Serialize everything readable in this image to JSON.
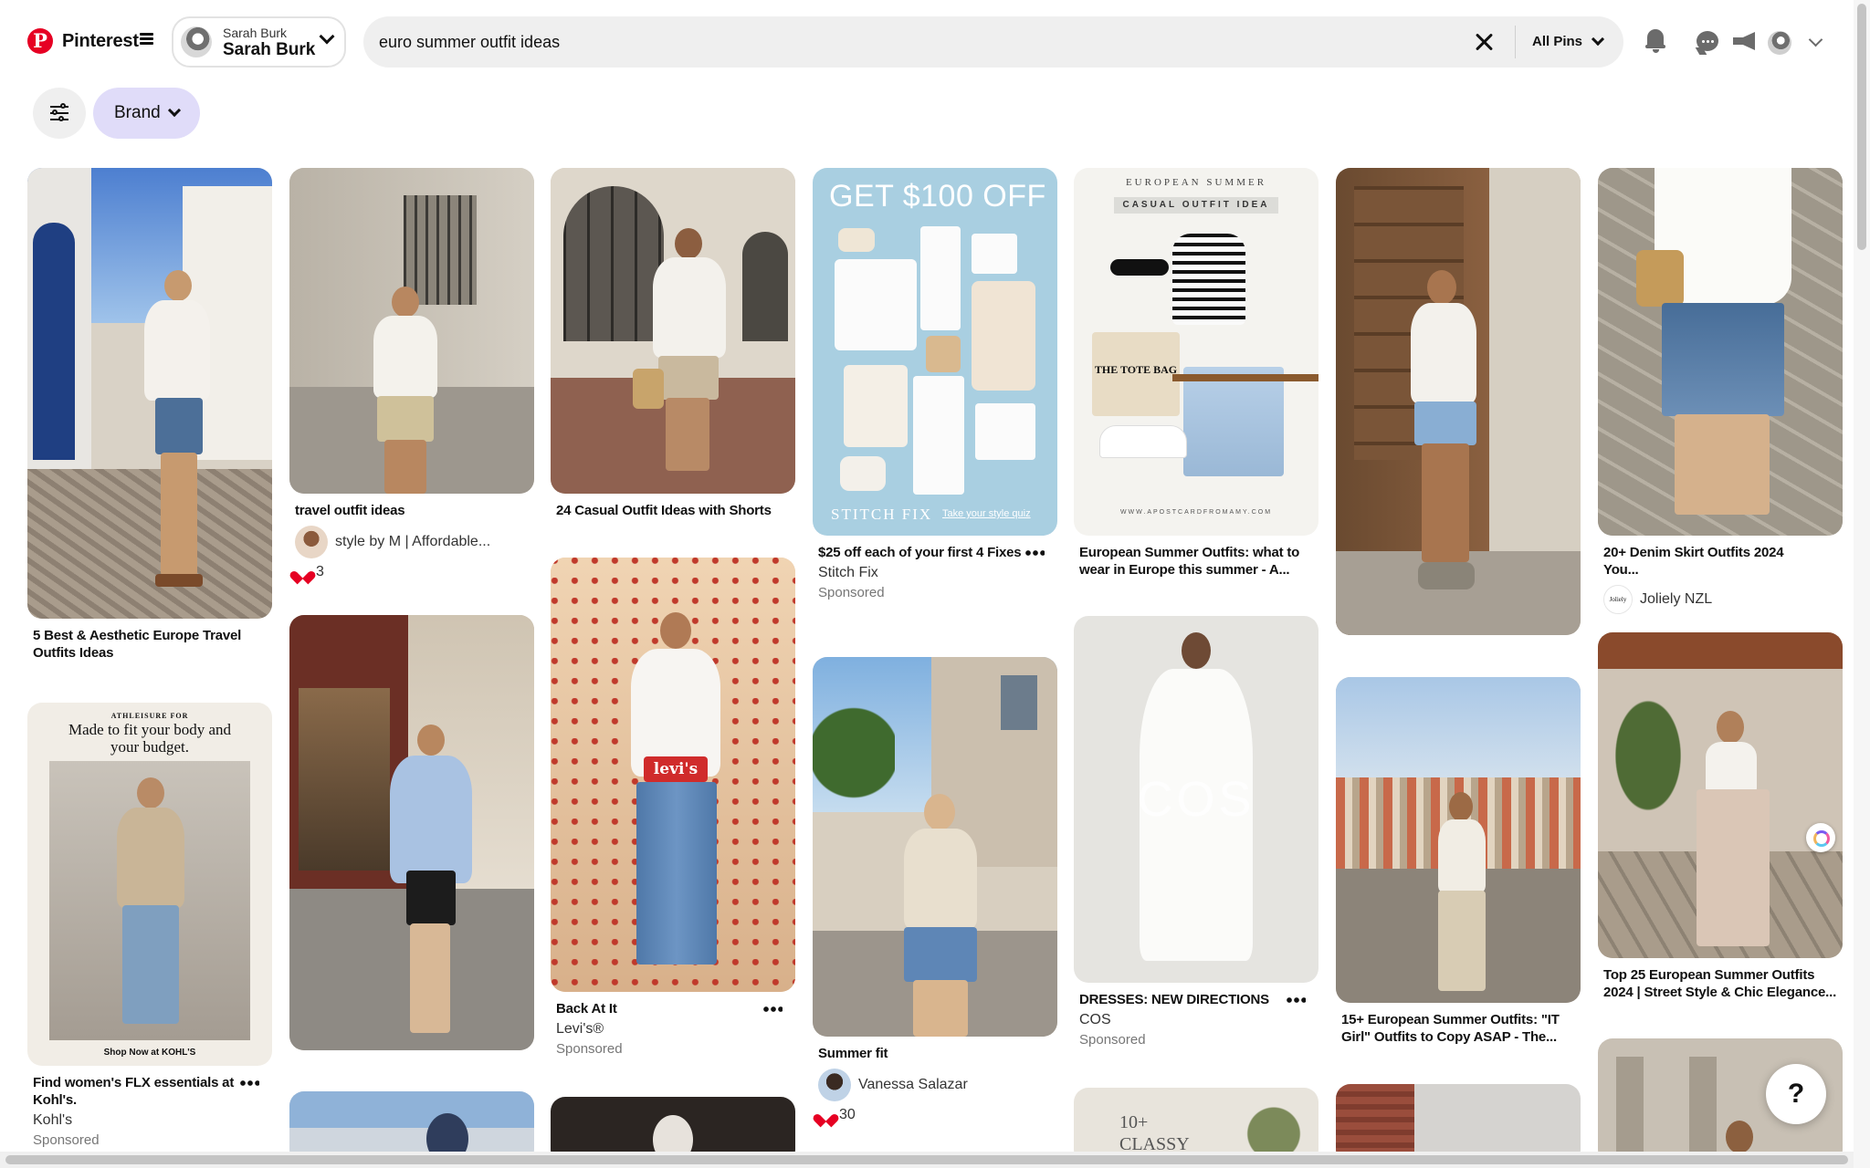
{
  "brand": {
    "logo_letter": "P",
    "name": "Pinterest"
  },
  "account": {
    "label": "Sarah Burk",
    "name": "Sarah Burk"
  },
  "search": {
    "query": "euro summer outfit ideas",
    "scope": "All Pins"
  },
  "filters": {
    "brand_label": "Brand"
  },
  "pins": [
    {
      "title": "5 Best & Aesthetic Europe Travel Outfits Ideas"
    },
    {
      "title": "Find women's FLX essentials at Kohl's.",
      "advertiser": "Kohl's",
      "sponsored": "Sponsored",
      "ad_top": "ATHLEISURE FOR",
      "ad_headline": "Made to fit your body and your budget.",
      "ad_cta": "Shop Now at KOHL'S"
    },
    {
      "title": "travel outfit ideas",
      "creator": "style by M | Affordable...",
      "likes": "3"
    },
    {
      "title": "24 Casual Outfit Ideas with Shorts"
    },
    {
      "title": "Back At It",
      "advertiser": "Levi's®",
      "sponsored": "Sponsored",
      "logo_text": "levi's"
    },
    {
      "title": "$25 off each of your first 4 Fixes",
      "advertiser": "Stitch Fix",
      "sponsored": "Sponsored",
      "ad_headline": "GET $100 OFF",
      "ad_brand": "STITCH FIX",
      "ad_cta": "Take your style quiz"
    },
    {
      "title": "Summer fit",
      "creator": "Vanessa Salazar",
      "likes": "30"
    },
    {
      "title": "European Summer Outfits: what to wear in Europe this summer - A...",
      "graphic_top": "EUROPEAN SUMMER",
      "graphic_sub": "CASUAL OUTFIT IDEA",
      "bag_text": "THE TOTE BAG",
      "graphic_url": "WWW.APOSTCARDFROMAMY.COM"
    },
    {
      "title": "DRESSES: NEW DIRECTIONS",
      "advertiser": "COS",
      "sponsored": "Sponsored",
      "logo_text": "COS"
    },
    {
      "title": "15+ European Summer Outfits: \"IT Girl\" Outfits to Copy ASAP - The..."
    },
    {
      "title": "20+ Denim Skirt Outfits 2024 You...",
      "creator": "Joliely NZL",
      "creator_logo": "Joliely"
    },
    {
      "title": "Top 25 European Summer Outfits 2024 | Street Style & Chic Elegance..."
    },
    {
      "graphic_text": "10+ CLASSY"
    }
  ],
  "help": "?",
  "colors": {
    "brand_red": "#e60023",
    "brand_pill": "#e0dcf9",
    "search_bg": "#efefef",
    "muted_text": "#767676"
  }
}
